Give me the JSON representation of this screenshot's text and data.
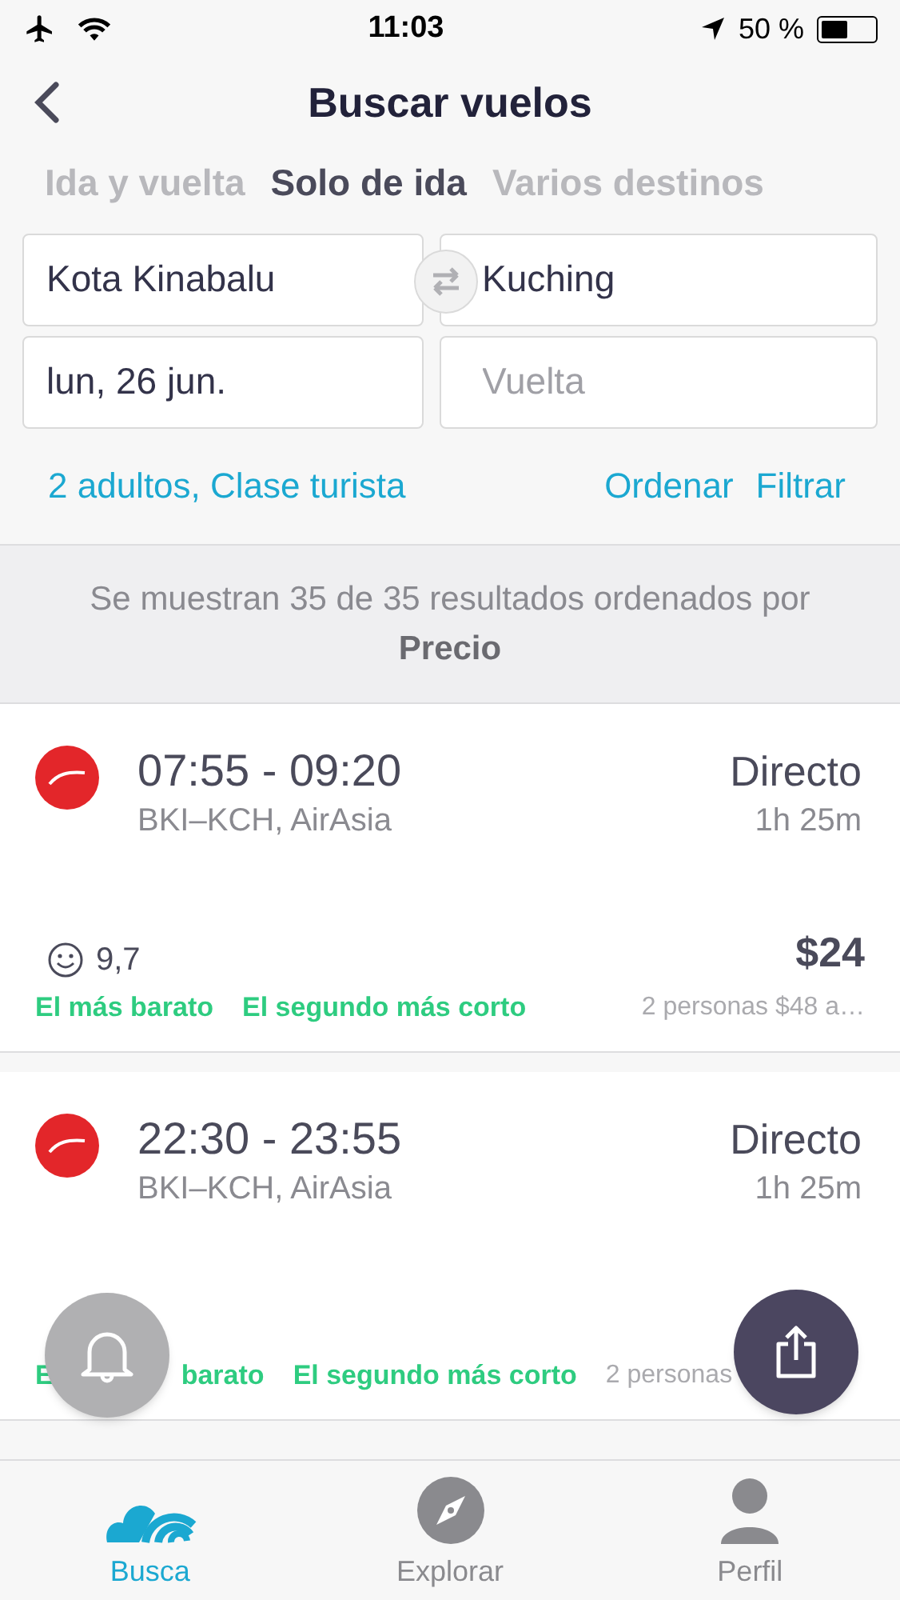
{
  "status_bar": {
    "time": "11:03",
    "battery": "50 %"
  },
  "header": {
    "title": "Buscar vuelos"
  },
  "trip_tabs": [
    {
      "label": "Ida y vuelta",
      "selected": false
    },
    {
      "label": "Solo de ida",
      "selected": true
    },
    {
      "label": "Varios destinos",
      "selected": false
    }
  ],
  "form": {
    "origin": {
      "value": "Kota Kinabalu"
    },
    "destination": {
      "value": "Kuching"
    },
    "departure": {
      "value": "lun, 26 jun."
    },
    "return": {
      "placeholder": "Vuelta"
    }
  },
  "options": {
    "passengers": "2 adultos, Clase turista",
    "sort": "Ordenar",
    "filter": "Filtrar"
  },
  "results_info": {
    "text": "Se muestran 35 de 35 resultados ordenados por **Precio**"
  },
  "results": [
    {
      "times": "07:55 - 09:20",
      "route": "BKI–KCH, AirAsia",
      "stops": "Directo",
      "duration": "1h 25m",
      "rating": "9,7",
      "price": "$24",
      "tags": [
        {
          "text": "El más barato",
          "kind": "full"
        },
        {
          "text": "El segundo más corto",
          "kind": "full"
        }
      ],
      "price_note": "2 personas $48 a…"
    },
    {
      "times": "22:30 - 23:55",
      "route": "BKI–KCH, AirAsia",
      "stops": "Directo",
      "duration": "1h 25m",
      "tags": [
        {
          "text": "E",
          "kind": "cut"
        },
        {
          "text": "barato",
          "kind": "full"
        },
        {
          "text": "El segundo más corto",
          "kind": "full"
        }
      ],
      "price_note": "2 personas"
    }
  ],
  "bottom_nav": [
    {
      "label": "Busca",
      "selected": true,
      "kind": "search"
    },
    {
      "label": "Explorar",
      "selected": false,
      "kind": "explore"
    },
    {
      "label": "Perfil",
      "selected": false,
      "kind": "profile"
    }
  ]
}
